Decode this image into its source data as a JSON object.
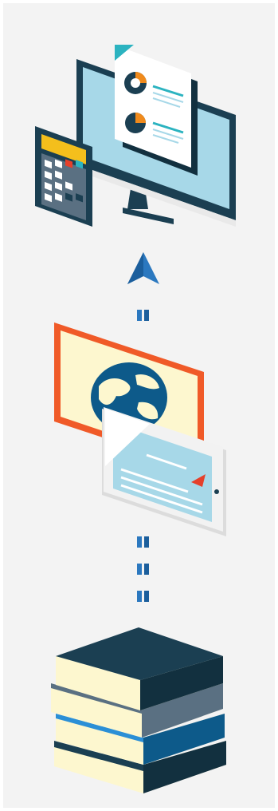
{
  "colors": {
    "panel_bg": "#f3f3f3",
    "navy": "#1b3f52",
    "navy_dark": "#12303f",
    "screen_blue": "#a7d8e8",
    "teal": "#2bb3c0",
    "orange": "#f08a1c",
    "red": "#e5402b",
    "cream": "#fdf7cf",
    "gray_slate": "#5a7082",
    "arrow_blue": "#2b78bf",
    "book_blue": "#2b8fd6"
  },
  "illustrations": {
    "top": [
      "calculator-icon",
      "computer-monitor-icon",
      "report-document-icon"
    ],
    "middle": [
      "globe-poster-icon",
      "tablet-icon"
    ],
    "bottom": [
      "book-stack-icon"
    ]
  },
  "connectors": [
    "arrow-up-icon",
    "dashed-line"
  ]
}
